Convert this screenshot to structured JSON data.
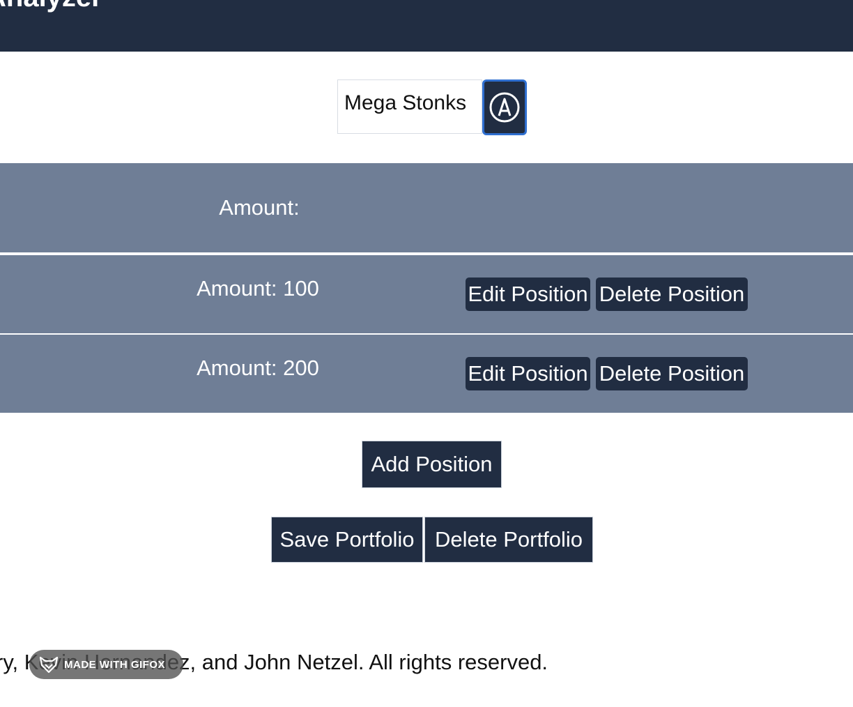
{
  "header": {
    "title": "Analyzer"
  },
  "portfolio": {
    "name": "Mega Stonks",
    "edit_icon": "edit-pen-circle-icon"
  },
  "positions_table": {
    "header_label": "Amount:",
    "rows": [
      {
        "amount_text": "Amount: 100",
        "edit_label": "Edit Position",
        "delete_label": "Delete Position"
      },
      {
        "amount_text": "Amount: 200",
        "edit_label": "Edit Position",
        "delete_label": "Delete Position"
      }
    ]
  },
  "actions": {
    "add_position_label": "Add Position",
    "save_portfolio_label": "Save Portfolio",
    "delete_portfolio_label": "Delete Portfolio"
  },
  "footer": {
    "copyright_text": "ry, Kevin Hernandez, and John Netzel. All rights reserved."
  },
  "watermark": {
    "text": "MADE WITH GIFOX",
    "icon": "fox-head-icon"
  },
  "colors": {
    "header_bg": "#212d42",
    "row_bg": "#6f7e96",
    "button_bg": "#212d42",
    "focus_ring": "#2f6fd0"
  }
}
